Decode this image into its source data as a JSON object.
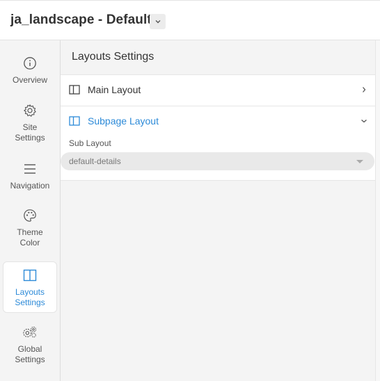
{
  "header": {
    "title": "ja_landscape - Default"
  },
  "sidebar": {
    "items": [
      {
        "label": "Overview",
        "icon": "info-icon"
      },
      {
        "label": "Site Settings",
        "icon": "gear-icon"
      },
      {
        "label": "Navigation",
        "icon": "menu-icon"
      },
      {
        "label": "Theme Color",
        "icon": "palette-icon"
      },
      {
        "label": "Layouts Settings",
        "icon": "layout-icon",
        "active": true
      },
      {
        "label": "Global Settings",
        "icon": "gears-icon"
      }
    ]
  },
  "main": {
    "title": "Layouts Settings",
    "sections": [
      {
        "label": "Main Layout",
        "expanded": false
      },
      {
        "label": "Subpage Layout",
        "expanded": true
      }
    ],
    "sub_layout": {
      "label": "Sub Layout",
      "value": "default-details"
    }
  },
  "colors": {
    "accent": "#2c8ad8",
    "sidebar_bg": "#f4f4f4",
    "text": "#333333"
  }
}
